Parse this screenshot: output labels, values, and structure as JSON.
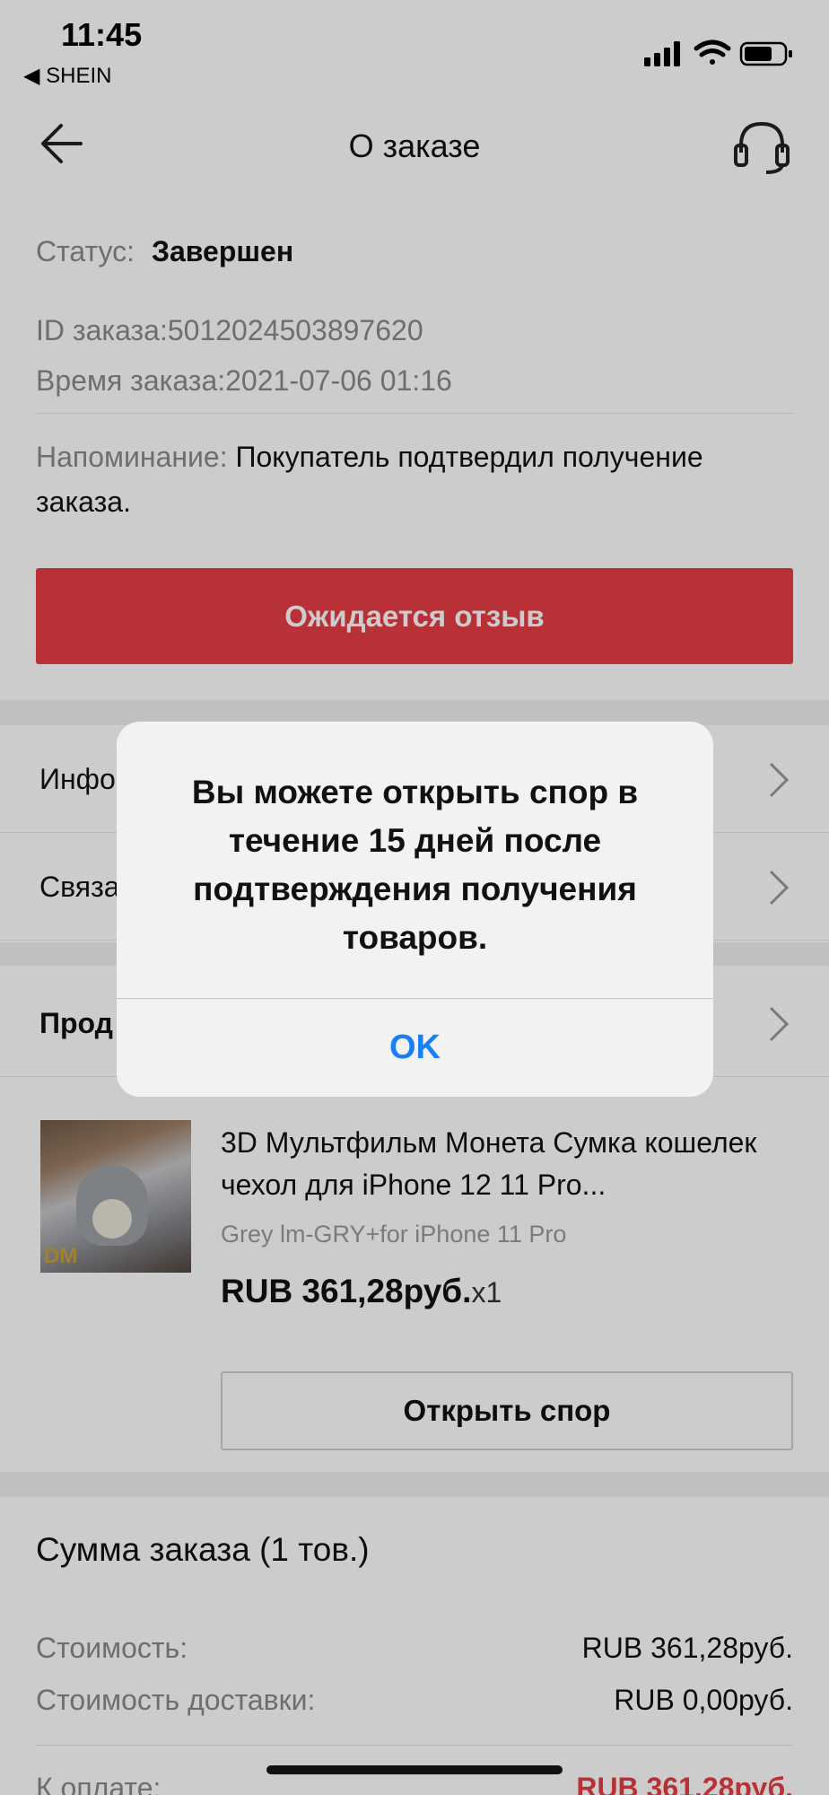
{
  "status_bar": {
    "time": "11:45",
    "back_app": "◀ SHEIN"
  },
  "nav": {
    "title": "О заказе"
  },
  "order": {
    "status_label": "Статус:",
    "status_value": "Завершен",
    "id_label": "ID заказа:",
    "id_value": "5012024503897620",
    "time_label": "Время заказа:",
    "time_value": "2021-07-06 01:16",
    "reminder_label": "Напоминание:",
    "reminder_text": "Покупатель подтвердил получение заказа.",
    "review_button": "Ожидается отзыв"
  },
  "rows": {
    "info_label": "Инфо",
    "contact_label": "Связа",
    "seller_label": "Прод"
  },
  "product": {
    "title": "3D Мультфильм Монета Сумка кошелек чехол для iPhone 12 11 Pro...",
    "variant": "Grey lm-GRY+for iPhone 11 Pro",
    "price": "RUB 361,28руб.",
    "qty": "x1",
    "image_badge": "DM",
    "dispute_button": "Открыть спор"
  },
  "summary": {
    "title": "Сумма заказа (1 тов.)",
    "cost_label": "Стоимость:",
    "cost_value": "RUB 361,28руб.",
    "shipping_label": "Стоимость доставки:",
    "shipping_value": "RUB 0,00руб.",
    "total_label": "К оплате:",
    "total_value": "RUB 361,28руб."
  },
  "dialog": {
    "message": "Вы можете открыть спор в течение 15 дней после подтверждения получения товаров.",
    "ok": "OK"
  },
  "colors": {
    "accent_red": "#e63e44",
    "ios_blue": "#1a7ff5"
  }
}
